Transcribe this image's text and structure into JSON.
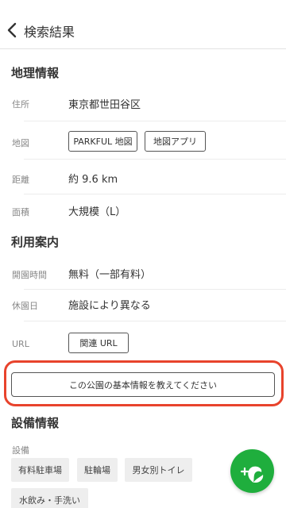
{
  "header": {
    "back_icon": "chevron-left-icon",
    "title": "検索結果"
  },
  "geo": {
    "section_title": "地理情報",
    "address_label": "住所",
    "address_value": "東京都世田谷区",
    "map_label": "地図",
    "map_buttons": [
      "PARKFUL 地図",
      "地図アプリ"
    ],
    "distance_label": "距離",
    "distance_value": "約 9.6 km",
    "area_label": "面積",
    "area_value": "大規模（L）"
  },
  "usage": {
    "section_title": "利用案内",
    "hours_label": "開園時間",
    "hours_value": "無料（一部有料）",
    "closed_label": "休園日",
    "closed_value": "施設により異なる",
    "url_label": "URL",
    "url_button": "関連 URL"
  },
  "teach_button": "この公園の基本情報を教えてください",
  "facilities": {
    "section_title": "設備情報",
    "label": "設備",
    "tags": [
      "有料駐車場",
      "駐輪場",
      "男女別トイレ",
      "水飲み・手洗い"
    ]
  },
  "fab": {
    "icon": "add-park-icon"
  },
  "colors": {
    "highlight": "#e8432c",
    "fab": "#1fae3d"
  }
}
